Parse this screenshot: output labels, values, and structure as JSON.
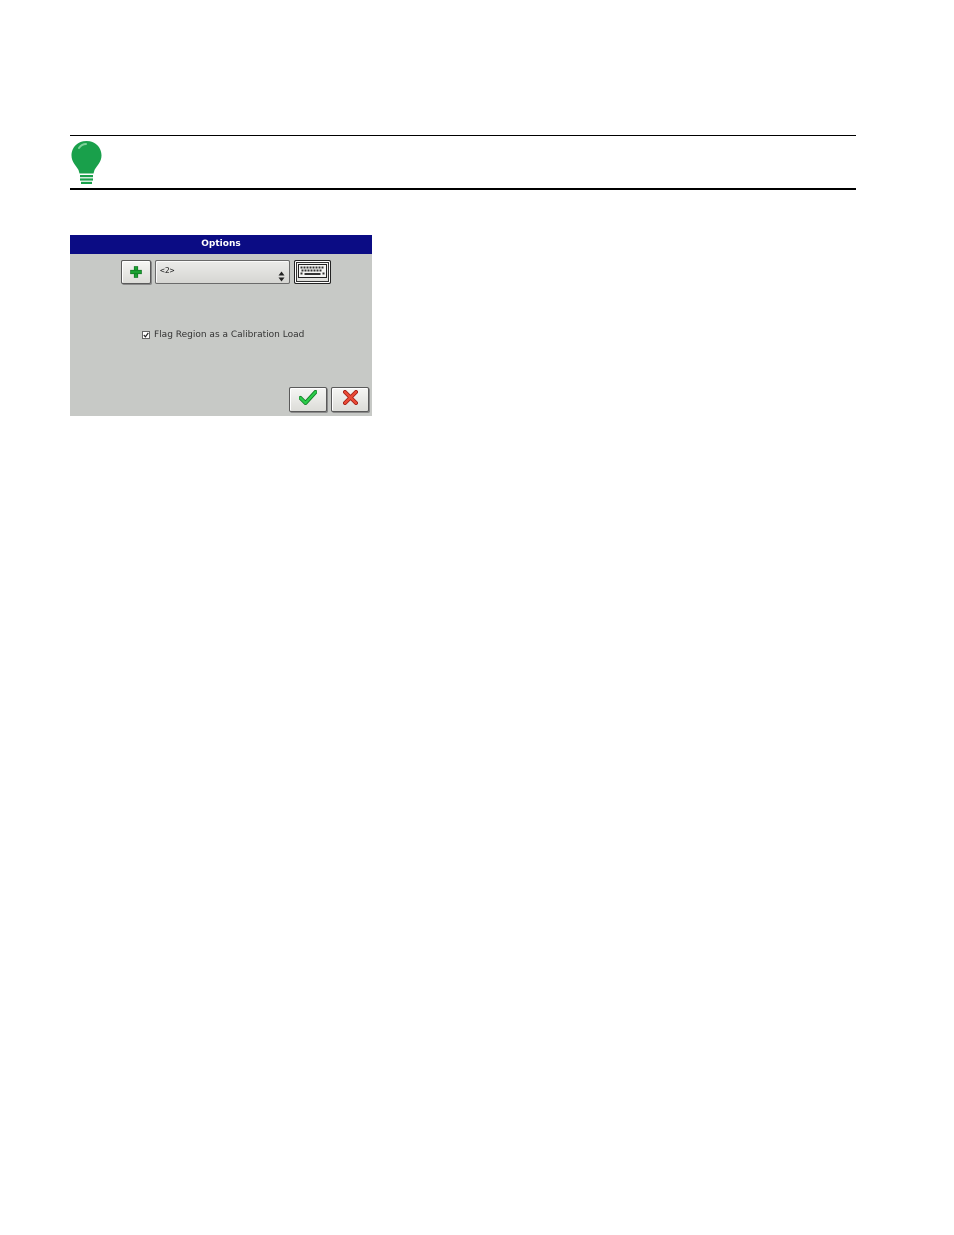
{
  "dialog": {
    "title": "Options",
    "selector": {
      "value": "<2>"
    },
    "checkbox": {
      "label": "Flag Region as a Calibration Load",
      "checked": true
    }
  },
  "icons": {
    "tip": "lightbulb-icon",
    "add": "plus-icon",
    "keyboard": "keyboard-icon",
    "ok": "checkmark-icon",
    "cancel": "x-icon",
    "dropdown": "up-down-arrows-icon"
  },
  "colors": {
    "title_bar": "#0b0c84",
    "dialog_bg": "#c7c9c6",
    "bulb_green": "#19a04b",
    "ok_green": "#1fae3a",
    "cancel_red": "#e2392b",
    "add_green": "#1aa232"
  }
}
